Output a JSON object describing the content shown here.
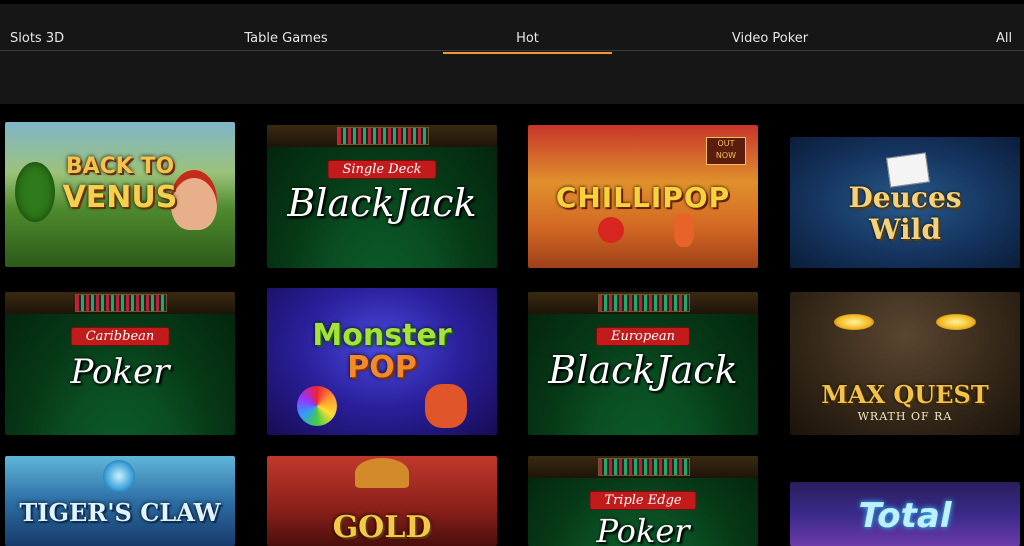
{
  "nav": {
    "tabs": [
      {
        "label": "Slots 3D",
        "active": false
      },
      {
        "label": "Table Games",
        "active": false
      },
      {
        "label": "Hot",
        "active": true
      },
      {
        "label": "Video Poker",
        "active": false
      },
      {
        "label": "All",
        "active": false
      }
    ],
    "accent_color": "#f39a2b"
  },
  "games": [
    {
      "title_line1": "BACK TO",
      "title_line2": "VENUS"
    },
    {
      "banner": "Single Deck",
      "title": "BlackJack"
    },
    {
      "title": "CHILLIPOP",
      "badge": "OUT NOW"
    },
    {
      "title_line1": "Deuces",
      "title_line2": "Wild"
    },
    {
      "banner": "Caribbean",
      "title": "Poker"
    },
    {
      "title_line1": "Monster",
      "title_line2": "POP"
    },
    {
      "banner": "European",
      "title": "BlackJack"
    },
    {
      "title": "MAX QUEST",
      "subtitle": "WRATH OF RA"
    },
    {
      "title": "TIGER'S CLAW"
    },
    {
      "title": "GOLD"
    },
    {
      "banner": "Triple Edge",
      "title": "Poker"
    },
    {
      "title": "Total"
    }
  ]
}
